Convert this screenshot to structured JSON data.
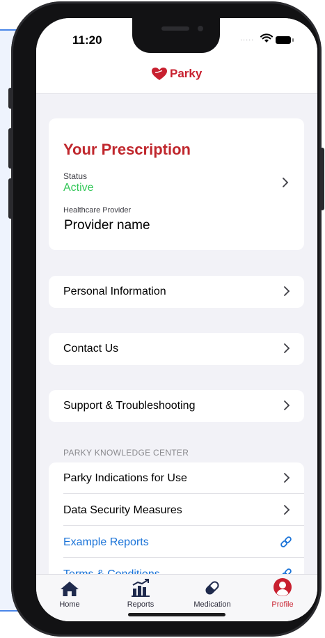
{
  "status_bar": {
    "time": "11:20",
    "signal": "....."
  },
  "header": {
    "app_name": "Parky",
    "brand_color": "#c8202f"
  },
  "prescription": {
    "title": "Your Prescription",
    "status_label": "Status",
    "status_value": "Active",
    "provider_label": "Healthcare Provider",
    "provider_value": "Provider name"
  },
  "menu": {
    "personal_info": "Personal Information",
    "contact_us": "Contact Us",
    "support": "Support & Troubleshooting"
  },
  "knowledge_center": {
    "header": "PARKY KNOWLEDGE CENTER",
    "items": [
      {
        "label": "Parky Indications for Use",
        "type": "chevron"
      },
      {
        "label": "Data Security Measures",
        "type": "chevron"
      },
      {
        "label": "Example Reports",
        "type": "link"
      },
      {
        "label": "Terms & Conditions",
        "type": "link"
      }
    ]
  },
  "tabs": [
    {
      "label": "Home",
      "icon": "home-icon"
    },
    {
      "label": "Reports",
      "icon": "reports-icon"
    },
    {
      "label": "Medication",
      "icon": "pill-icon"
    },
    {
      "label": "Profile",
      "icon": "profile-icon",
      "active": true
    }
  ],
  "colors": {
    "active_green": "#34c759",
    "link_blue": "#1a73d8",
    "accent_red": "#c8202f"
  }
}
